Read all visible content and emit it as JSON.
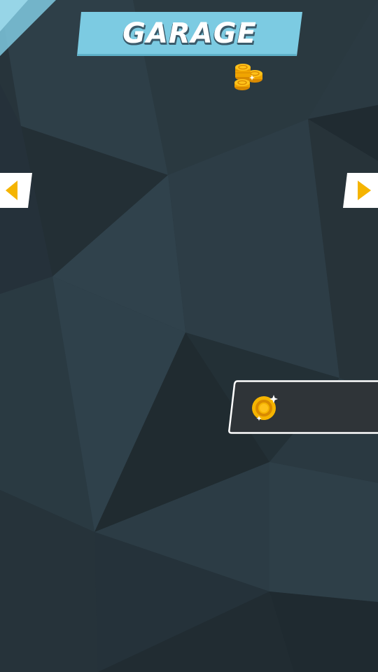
{
  "screen": {
    "title": "GARAGE",
    "background_color": "#27343b",
    "banner_color": "#7ccbe2",
    "accent_color": "#f5b400"
  },
  "icons": {
    "coin_stack": "coin-stack-icon",
    "prev": "arrow-left-icon",
    "next": "arrow-right-icon",
    "currency": "gold-coin-icon"
  },
  "currency": {
    "value": ""
  }
}
